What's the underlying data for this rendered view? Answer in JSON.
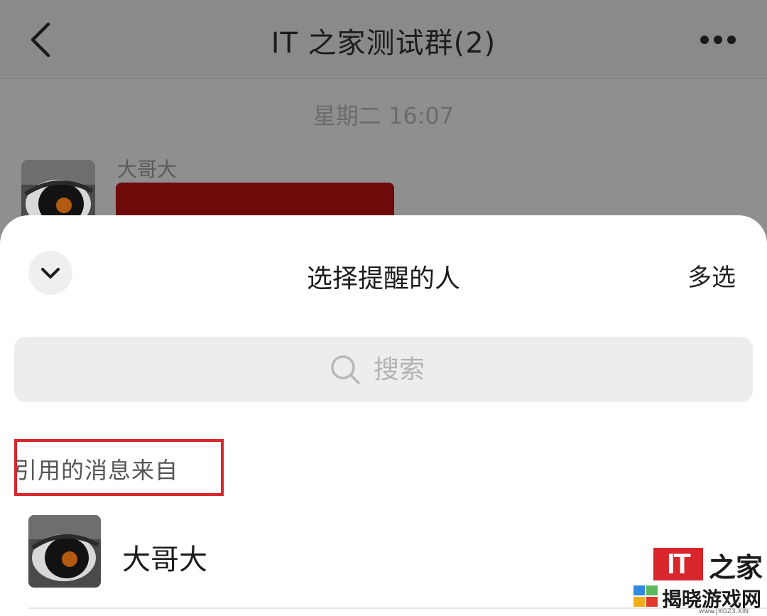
{
  "chat": {
    "title": "IT 之家测试群(2)",
    "timestamp": "星期二 16:07",
    "message": {
      "sender": "大哥大"
    }
  },
  "sheet": {
    "title": "选择提醒的人",
    "multi_select_label": "多选",
    "search": {
      "placeholder": "搜索"
    },
    "section_label": "引用的消息来自",
    "contacts": [
      {
        "name": "大哥大"
      }
    ]
  },
  "watermark": {
    "logo_text": "IT",
    "logo_suffix": "之家",
    "site_name": "揭晓游戏网",
    "site_url": "www.JXGZ3.XIN"
  },
  "colors": {
    "highlight_box": "#d8262d",
    "bubble": "#6e0a0a",
    "overlay": "#8f8f8f"
  }
}
